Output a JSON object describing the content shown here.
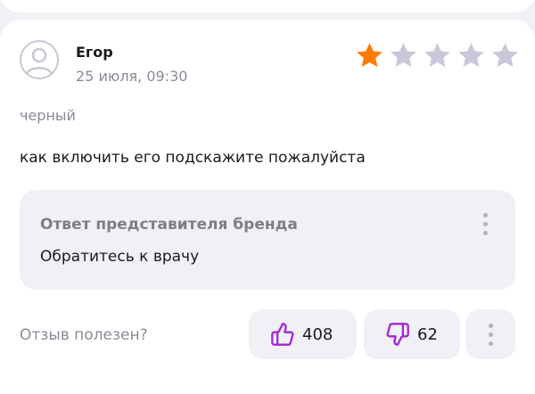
{
  "review": {
    "author": "Егор",
    "date": "25 июля, 09:30",
    "rating": 1,
    "rating_max": 5,
    "variant": "черный",
    "text": "как включить его подскажите пожалуйста"
  },
  "brand_reply": {
    "title": "Ответ представителя бренда",
    "text": "Обратитесь к врачу"
  },
  "feedback": {
    "question": "Отзыв полезен?",
    "likes": "408",
    "dislikes": "62"
  },
  "colors": {
    "star_active": "#FF7A00",
    "star_inactive": "#C9C7D9",
    "vote_icon": "#A128D4",
    "background": "#F1F0F6"
  },
  "icons": {
    "avatar": "user-icon",
    "rating": "star-icon",
    "like": "thumbs-up-icon",
    "dislike": "thumbs-down-icon",
    "menu": "more-vertical-icon"
  }
}
